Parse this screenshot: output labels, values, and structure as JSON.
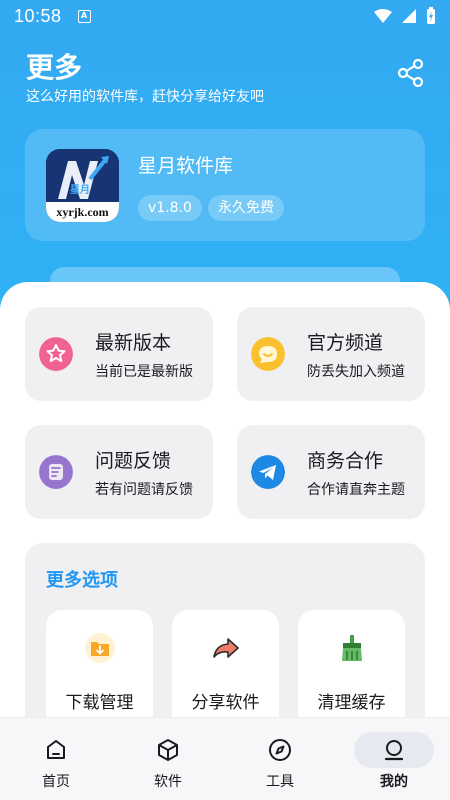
{
  "status": {
    "time": "10:58"
  },
  "header": {
    "title": "更多",
    "subtitle": "这么好用的软件库，赶快分享给好友吧",
    "share_icon": "share-icon"
  },
  "app": {
    "logo_text": "xyrjk.com",
    "logo_mark": "星月",
    "name": "星月软件库",
    "version": "v1.8.0",
    "license": "永久免费"
  },
  "tiles": [
    {
      "title": "最新版本",
      "subtitle": "当前已是最新版",
      "icon": "star-icon",
      "color": "#f06292"
    },
    {
      "title": "官方频道",
      "subtitle": "防丢失加入频道",
      "icon": "chat-icon",
      "color": "#fbc02d"
    },
    {
      "title": "问题反馈",
      "subtitle": "若有问题请反馈",
      "icon": "feedback-icon",
      "color": "#9575cd"
    },
    {
      "title": "商务合作",
      "subtitle": "合作请直奔主题",
      "icon": "telegram-icon",
      "color": "#1e88e5"
    }
  ],
  "more": {
    "title": "更多选项",
    "options": [
      {
        "label": "下载管理",
        "icon": "download-folder-icon"
      },
      {
        "label": "分享软件",
        "icon": "share-arrow-icon"
      },
      {
        "label": "清理缓存",
        "icon": "broom-icon"
      }
    ]
  },
  "nav": {
    "items": [
      {
        "label": "首页",
        "icon": "home-icon"
      },
      {
        "label": "软件",
        "icon": "cube-icon"
      },
      {
        "label": "工具",
        "icon": "compass-icon"
      },
      {
        "label": "我的",
        "icon": "profile-icon"
      }
    ],
    "active_index": 3
  },
  "colors": {
    "brand": "#33a9f2",
    "accent": "#2196f3"
  }
}
